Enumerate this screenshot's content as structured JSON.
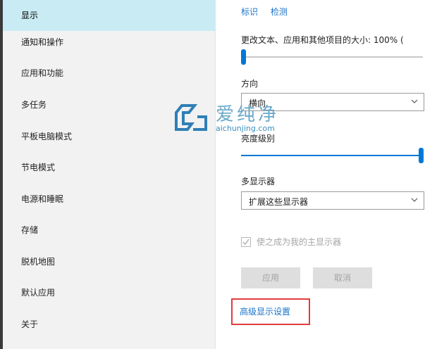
{
  "nav": {
    "items": [
      {
        "label": "显示",
        "selected": true
      },
      {
        "label": "通知和操作"
      },
      {
        "label": "应用和功能"
      },
      {
        "label": "多任务"
      },
      {
        "label": "平板电脑模式"
      },
      {
        "label": "节电模式"
      },
      {
        "label": "电源和睡眠"
      },
      {
        "label": "存储"
      },
      {
        "label": "脱机地图"
      },
      {
        "label": "默认应用"
      },
      {
        "label": "关于"
      }
    ]
  },
  "display": {
    "links": {
      "identify": "标识",
      "detect": "检测"
    },
    "scale_label": "更改文本、应用和其他项目的大小: 100% (",
    "scale_value_percent": 0,
    "orientation": {
      "label": "方向",
      "value": "横向"
    },
    "brightness": {
      "label": "亮度级别",
      "value_percent": 100
    },
    "multi_display": {
      "label": "多显示器",
      "value": "扩展这些显示器"
    },
    "main_display_checkbox": {
      "label": "使之成为我的主显示器",
      "checked": true,
      "disabled": true
    },
    "buttons": {
      "apply": "应用",
      "cancel": "取消"
    },
    "advanced_link": "高级显示设置"
  },
  "watermark": {
    "cn": "爱纯净",
    "en": "aichunjing.com"
  },
  "colors": {
    "accent": "#0078d7",
    "link": "#1a73c7",
    "highlight": "#c9ecf4",
    "annotation": "#e23b3b"
  }
}
